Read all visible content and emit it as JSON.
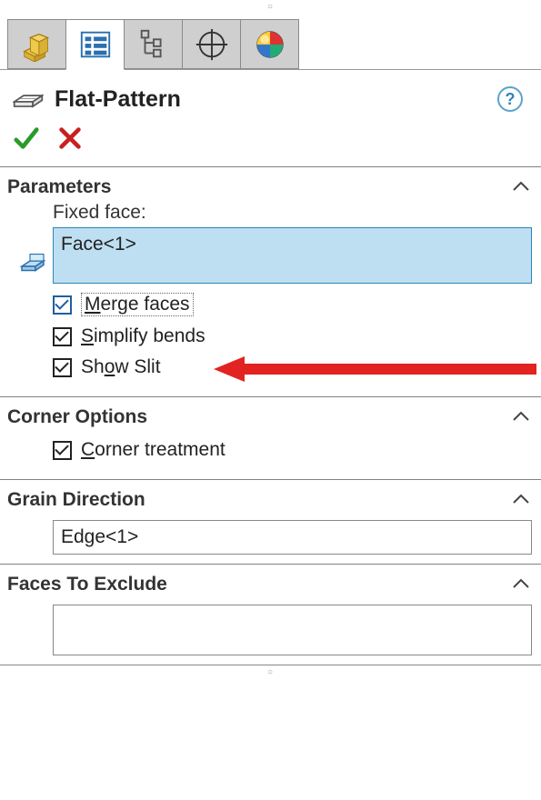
{
  "feature": {
    "title": "Flat-Pattern"
  },
  "tabs": {
    "active_index": 1
  },
  "sections": {
    "parameters": {
      "title": "Parameters",
      "fixed_face_label": "Fixed face:",
      "fixed_face_value": "Face<1>",
      "merge_faces": {
        "label": "Merge faces",
        "mnemonic": "M",
        "checked": true
      },
      "simplify_bends": {
        "label": "Simplify bends",
        "mnemonic": "S",
        "checked": true
      },
      "show_slit": {
        "label": "Show Slit",
        "mnemonic": "o",
        "checked": true
      }
    },
    "corner_options": {
      "title": "Corner Options",
      "corner_treatment": {
        "label": "Corner treatment",
        "mnemonic": "C",
        "checked": true
      }
    },
    "grain_direction": {
      "title": "Grain Direction",
      "value": "Edge<1>"
    },
    "faces_to_exclude": {
      "title": "Faces To Exclude",
      "value": ""
    }
  }
}
